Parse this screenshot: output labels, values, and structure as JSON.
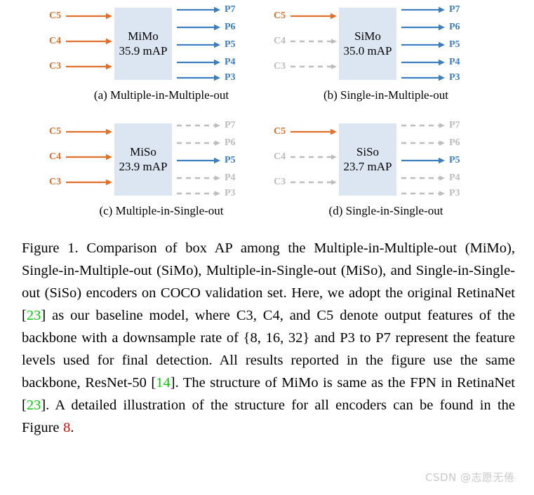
{
  "figure": {
    "panels": [
      {
        "key": "a",
        "encoder_name": "MiMo",
        "encoder_map": "35.9 mAP",
        "caption": "(a) Multiple-in-Multiple-out",
        "inputs": [
          {
            "label": "C5",
            "active": true
          },
          {
            "label": "C4",
            "active": true
          },
          {
            "label": "C3",
            "active": true
          }
        ],
        "outputs": [
          {
            "label": "P7",
            "active": true
          },
          {
            "label": "P6",
            "active": true
          },
          {
            "label": "P5",
            "active": true
          },
          {
            "label": "P4",
            "active": true
          },
          {
            "label": "P3",
            "active": true
          }
        ]
      },
      {
        "key": "b",
        "encoder_name": "SiMo",
        "encoder_map": "35.0 mAP",
        "caption": "(b) Single-in-Multiple-out",
        "inputs": [
          {
            "label": "C5",
            "active": true
          },
          {
            "label": "C4",
            "active": false
          },
          {
            "label": "C3",
            "active": false
          }
        ],
        "outputs": [
          {
            "label": "P7",
            "active": true
          },
          {
            "label": "P6",
            "active": true
          },
          {
            "label": "P5",
            "active": true
          },
          {
            "label": "P4",
            "active": true
          },
          {
            "label": "P3",
            "active": true
          }
        ]
      },
      {
        "key": "c",
        "encoder_name": "MiSo",
        "encoder_map": "23.9 mAP",
        "caption": "(c) Multiple-in-Single-out",
        "inputs": [
          {
            "label": "C5",
            "active": true
          },
          {
            "label": "C4",
            "active": true
          },
          {
            "label": "C3",
            "active": true
          }
        ],
        "outputs": [
          {
            "label": "P7",
            "active": false
          },
          {
            "label": "P6",
            "active": false
          },
          {
            "label": "P5",
            "active": true
          },
          {
            "label": "P4",
            "active": false
          },
          {
            "label": "P3",
            "active": false
          }
        ]
      },
      {
        "key": "d",
        "encoder_name": "SiSo",
        "encoder_map": "23.7 mAP",
        "caption": "(d) Single-in-Single-out",
        "inputs": [
          {
            "label": "C5",
            "active": true
          },
          {
            "label": "C4",
            "active": false
          },
          {
            "label": "C3",
            "active": false
          }
        ],
        "outputs": [
          {
            "label": "P7",
            "active": false
          },
          {
            "label": "P6",
            "active": false
          },
          {
            "label": "P5",
            "active": true
          },
          {
            "label": "P4",
            "active": false
          },
          {
            "label": "P3",
            "active": false
          }
        ]
      }
    ]
  },
  "caption": {
    "segments": [
      {
        "text": "Figure 1. Comparison of box AP among the Multiple-in-Multiple-out (MiMo), Single-in-Multiple-out (SiMo), Multiple-in-Single-out (MiSo), and Single-in-Single-out (SiSo) encoders on COCO validation set. Here, we adopt the original RetinaNet [",
        "style": "plain"
      },
      {
        "text": "23",
        "style": "cite-green"
      },
      {
        "text": "] as our baseline model, where C3, C4, and C5 denote output features of the backbone with a downsample rate of {8, 16, 32} and P3 to P7 represent the feature levels used for final detection. All results reported in the figure use the same backbone, ResNet-50 [",
        "style": "plain"
      },
      {
        "text": "14",
        "style": "cite-green"
      },
      {
        "text": "]. The structure of MiMo is same as the FPN in RetinaNet [",
        "style": "plain"
      },
      {
        "text": "23",
        "style": "cite-green"
      },
      {
        "text": "]. A detailed illustration of the structure for all encoders can be found in the Figure ",
        "style": "plain"
      },
      {
        "text": "8",
        "style": "cite-red"
      },
      {
        "text": ".",
        "style": "plain"
      }
    ]
  },
  "watermark": {
    "text": "CSDN @志愿无倦"
  },
  "colors": {
    "input_active": "#E3702A",
    "output_active": "#3C7EBF",
    "inactive": "#BDBDBD",
    "box_fill": "#dce6f2",
    "cite_green": "#00CC00",
    "cite_red": "#EE0000"
  }
}
